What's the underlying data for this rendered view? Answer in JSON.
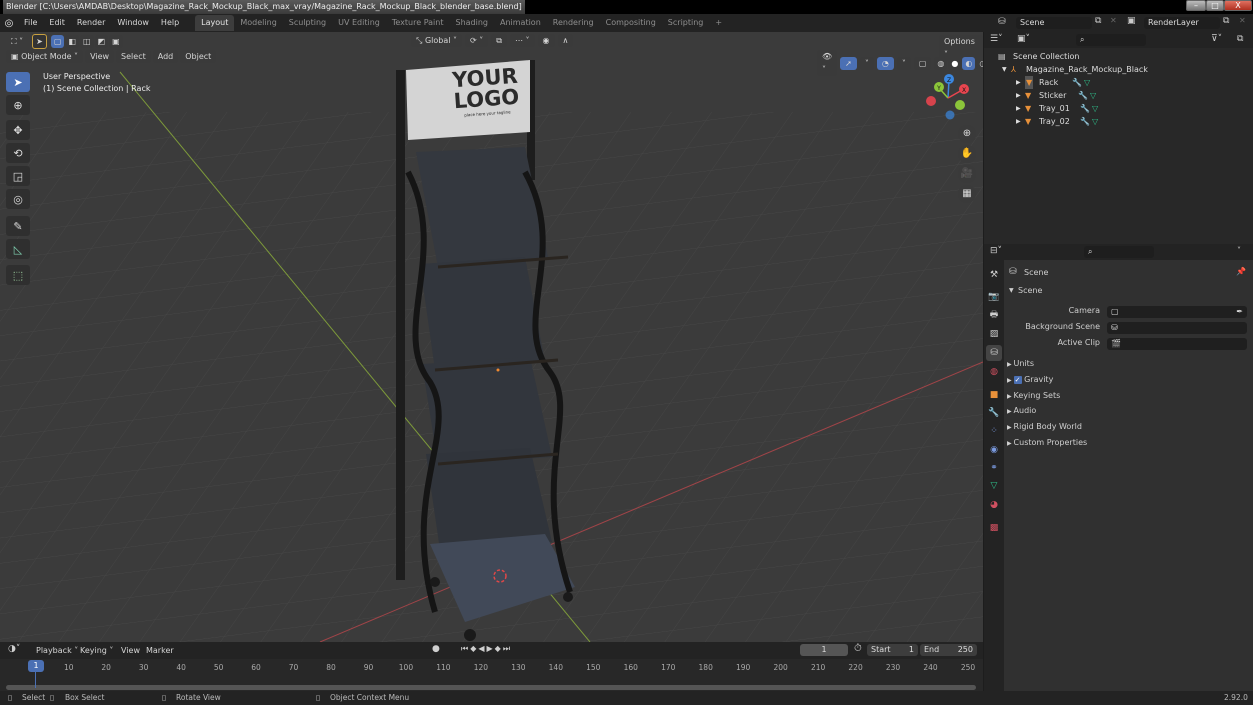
{
  "window": {
    "title": "Blender [C:\\Users\\AMDAB\\Desktop\\Magazine_Rack_Mockup_Black_max_vray/Magazine_Rack_Mockup_Black_blender_base.blend]",
    "minimize": "–",
    "maximize": "□",
    "close": "X"
  },
  "menu": [
    "File",
    "Edit",
    "Render",
    "Window",
    "Help"
  ],
  "workspaces": [
    {
      "label": "Layout",
      "active": true
    },
    {
      "label": "Modeling"
    },
    {
      "label": "Sculpting"
    },
    {
      "label": "UV Editing"
    },
    {
      "label": "Texture Paint"
    },
    {
      "label": "Shading"
    },
    {
      "label": "Animation"
    },
    {
      "label": "Rendering"
    },
    {
      "label": "Compositing"
    },
    {
      "label": "Scripting"
    }
  ],
  "add_workspace": "+",
  "scene_selector": {
    "value": "Scene"
  },
  "render_layer": {
    "value": "RenderLayer"
  },
  "viewport": {
    "transform_orientation": "Global",
    "options": "Options",
    "mode": "Object Mode",
    "menus": [
      "View",
      "Select",
      "Add",
      "Object"
    ],
    "perspective": "User Perspective",
    "collection_info": "(1) Scene Collection | Rack",
    "logo_line1": "YOUR",
    "logo_line2": "LOGO",
    "logo_tagline": "place here your tagline",
    "gizmo": {
      "z": "Z",
      "y": "Y",
      "x": "X"
    }
  },
  "outliner": {
    "root": "Scene Collection",
    "collection": "Magazine_Rack_Mockup_Black",
    "objects": [
      "Rack",
      "Sticker",
      "Tray_01",
      "Tray_02"
    ]
  },
  "properties": {
    "context": "Scene",
    "panel": "Scene",
    "fields": [
      {
        "label": "Camera",
        "value": ""
      },
      {
        "label": "Background Scene",
        "value": ""
      },
      {
        "label": "Active Clip",
        "value": ""
      }
    ],
    "subpanels": [
      {
        "label": "Units"
      },
      {
        "label": "Gravity",
        "checkbox": true,
        "checked": true
      },
      {
        "label": "Keying Sets"
      },
      {
        "label": "Audio"
      },
      {
        "label": "Rigid Body World"
      },
      {
        "label": "Custom Properties"
      }
    ]
  },
  "timeline": {
    "menus": [
      "Playback",
      "Keying",
      "View",
      "Marker"
    ],
    "current_frame": "1",
    "start_label": "Start",
    "start": "1",
    "end_label": "End",
    "end": "250",
    "ticks": [
      "10",
      "20",
      "30",
      "40",
      "50",
      "60",
      "70",
      "80",
      "90",
      "100",
      "110",
      "120",
      "130",
      "140",
      "150",
      "160",
      "170",
      "180",
      "190",
      "200",
      "210",
      "220",
      "230",
      "240",
      "250"
    ]
  },
  "statusbar": {
    "select": "Select",
    "box_select": "Box Select",
    "rotate_view": "Rotate View",
    "context_menu": "Object Context Menu",
    "version": "2.92.0"
  },
  "colors": {
    "accent": "#4b70b4",
    "object_orange": "#e8913a",
    "mesh_green": "#2fbf8a",
    "axis_x": "#e8454f",
    "axis_y": "#8bc53a",
    "axis_z": "#3b87e0"
  }
}
